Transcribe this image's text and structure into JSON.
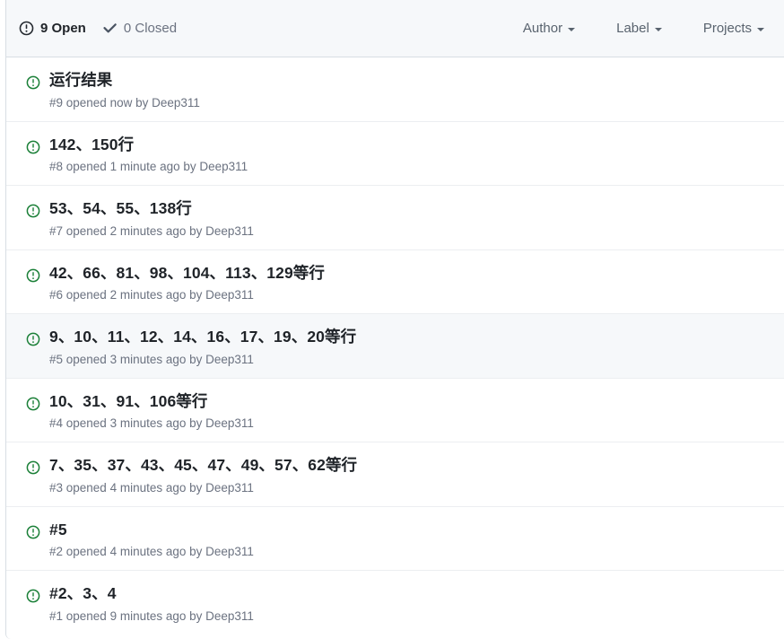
{
  "header": {
    "open_filter": {
      "label": "9 Open",
      "icon": "issue-opened-icon",
      "count": 9,
      "state": "open",
      "selected": true
    },
    "closed_filter": {
      "label": "0 Closed",
      "icon": "check-icon",
      "count": 0,
      "state": "closed",
      "selected": false
    },
    "menus": [
      {
        "label": "Author",
        "name": "author"
      },
      {
        "label": "Label",
        "name": "label"
      },
      {
        "label": "Projects",
        "name": "projects"
      }
    ]
  },
  "colors": {
    "open_green": "#1a7f37",
    "header_bg": "#f6f8fa",
    "border": "#d8dee4",
    "row_divider": "#eceef1",
    "hover_bg": "#f6f8fa",
    "title": "#1f2328",
    "meta": "#6b7280"
  },
  "issues": [
    {
      "title": "运行结果",
      "meta": "#9 opened now by Deep311",
      "number": "#9",
      "opened": "now",
      "author": "Deep311",
      "state": "open",
      "hovered": false
    },
    {
      "title": "142、150行",
      "meta": "#8 opened 1 minute ago by Deep311",
      "number": "#8",
      "opened": "1 minute ago",
      "author": "Deep311",
      "state": "open",
      "hovered": false
    },
    {
      "title": "53、54、55、138行",
      "meta": "#7 opened 2 minutes ago by Deep311",
      "number": "#7",
      "opened": "2 minutes ago",
      "author": "Deep311",
      "state": "open",
      "hovered": false
    },
    {
      "title": "42、66、81、98、104、113、129等行",
      "meta": "#6 opened 2 minutes ago by Deep311",
      "number": "#6",
      "opened": "2 minutes ago",
      "author": "Deep311",
      "state": "open",
      "hovered": false
    },
    {
      "title": "9、10、11、12、14、16、17、19、20等行",
      "meta": "#5 opened 3 minutes ago by Deep311",
      "number": "#5",
      "opened": "3 minutes ago",
      "author": "Deep311",
      "state": "open",
      "hovered": true
    },
    {
      "title": "10、31、91、106等行",
      "meta": "#4 opened 3 minutes ago by Deep311",
      "number": "#4",
      "opened": "3 minutes ago",
      "author": "Deep311",
      "state": "open",
      "hovered": false
    },
    {
      "title": "7、35、37、43、45、47、49、57、62等行",
      "meta": "#3 opened 4 minutes ago by Deep311",
      "number": "#3",
      "opened": "4 minutes ago",
      "author": "Deep311",
      "state": "open",
      "hovered": false
    },
    {
      "title": "#5",
      "meta": "#2 opened 4 minutes ago by Deep311",
      "number": "#2",
      "opened": "4 minutes ago",
      "author": "Deep311",
      "state": "open",
      "hovered": false
    },
    {
      "title": "#2、3、4",
      "meta": "#1 opened 9 minutes ago by Deep311",
      "number": "#1",
      "opened": "9 minutes ago",
      "author": "Deep311",
      "state": "open",
      "hovered": false
    }
  ]
}
